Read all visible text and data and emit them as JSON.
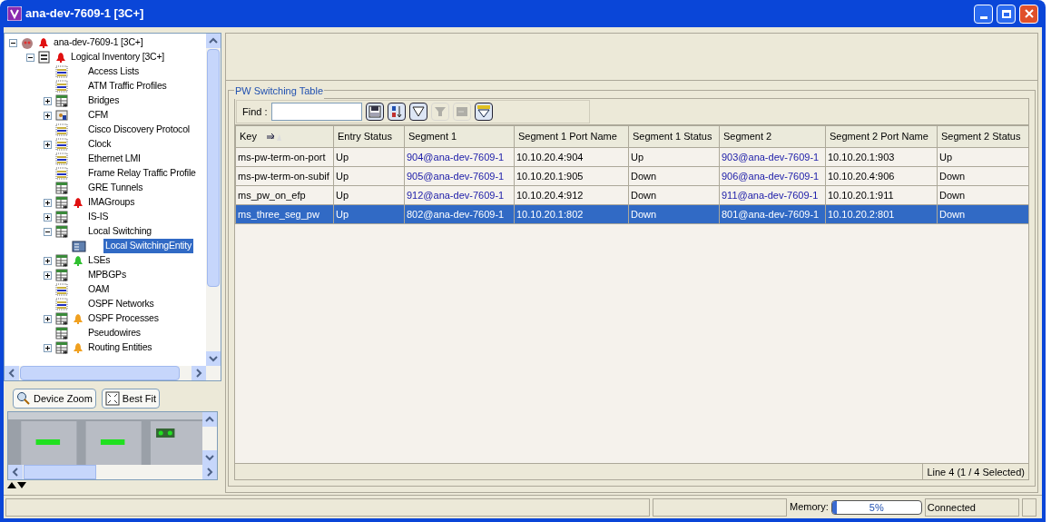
{
  "window": {
    "title": "ana-dev-7609-1 [3C+]"
  },
  "tree": [
    {
      "label": "ana-dev-7609-1 [3C+]",
      "kind": "device",
      "expanded": true,
      "selected": false,
      "color": "#e01010",
      "children": [
        {
          "label": "Logical Inventory [3C+]",
          "kind": "inventory",
          "expanded": true,
          "selected": false,
          "color": "#e01010",
          "children": [
            {
              "label": "Access Lists",
              "kind": "list",
              "selected": false
            },
            {
              "label": "ATM Traffic Profiles",
              "kind": "list",
              "selected": false
            },
            {
              "label": "Bridges",
              "kind": "table",
              "expanded": false,
              "selected": false
            },
            {
              "label": "CFM",
              "kind": "cfm",
              "expanded": false,
              "selected": false
            },
            {
              "label": "Cisco Discovery Protocol",
              "kind": "list",
              "selected": false
            },
            {
              "label": "Clock",
              "kind": "list",
              "expanded": false,
              "selected": false
            },
            {
              "label": "Ethernet LMI",
              "kind": "list",
              "selected": false
            },
            {
              "label": "Frame Relay Traffic Profile",
              "kind": "list",
              "selected": false
            },
            {
              "label": "GRE Tunnels",
              "kind": "table",
              "selected": false
            },
            {
              "label": "IMAGroups",
              "kind": "table",
              "expanded": false,
              "selected": false,
              "color": "#e01010"
            },
            {
              "label": "IS-IS",
              "kind": "table",
              "expanded": false,
              "selected": false
            },
            {
              "label": "Local Switching",
              "kind": "table",
              "expanded": true,
              "selected": false,
              "children": [
                {
                  "label": "Local SwitchingEntity",
                  "kind": "entity",
                  "selected": true
                }
              ]
            },
            {
              "label": "LSEs",
              "kind": "table",
              "expanded": false,
              "selected": false,
              "color": "#30c030"
            },
            {
              "label": "MPBGPs",
              "kind": "table",
              "expanded": false,
              "selected": false
            },
            {
              "label": "OAM",
              "kind": "list",
              "selected": false
            },
            {
              "label": "OSPF Networks",
              "kind": "list",
              "selected": false
            },
            {
              "label": "OSPF Processes",
              "kind": "table",
              "expanded": false,
              "selected": false,
              "color": "#f0a020"
            },
            {
              "label": "Pseudowires",
              "kind": "table",
              "selected": false
            },
            {
              "label": "Routing Entities",
              "kind": "table",
              "expanded": false,
              "selected": false,
              "color": "#f0a020"
            }
          ]
        }
      ]
    }
  ],
  "view_buttons": [
    {
      "label": "Device Zoom",
      "kind": "zoom"
    },
    {
      "label": "Best Fit",
      "kind": "fit"
    }
  ],
  "table": {
    "title": "PW Switching Table",
    "find_label": "Find :",
    "toolbar": [
      {
        "kind": "save",
        "disabled": false
      },
      {
        "kind": "sort",
        "disabled": false
      },
      {
        "kind": "filter",
        "disabled": false
      },
      {
        "kind": "clear-filter",
        "disabled": true
      },
      {
        "kind": "export",
        "disabled": true
      },
      {
        "kind": "filter-settings",
        "disabled": false
      }
    ],
    "columns": [
      "Key",
      "Entry Status",
      "Segment 1",
      "Segment 1 Port Name",
      "Segment 1 Status",
      "Segment 2",
      "Segment 2 Port Name",
      "Segment 2 Status"
    ],
    "rows": [
      {
        "selected": false,
        "cells": [
          "ms-pw-term-on-port",
          "Up",
          "904@ana-dev-7609-1",
          "10.10.20.4:904",
          "Up",
          "903@ana-dev-7609-1",
          "10.10.20.1:903",
          "Up"
        ]
      },
      {
        "selected": false,
        "cells": [
          "ms-pw-term-on-subif",
          "Up",
          "905@ana-dev-7609-1",
          "10.10.20.1:905",
          "Down",
          "906@ana-dev-7609-1",
          "10.10.20.4:906",
          "Down"
        ]
      },
      {
        "selected": false,
        "cells": [
          "ms_pw_on_efp",
          "Up",
          "912@ana-dev-7609-1",
          "10.10.20.4:912",
          "Down",
          "911@ana-dev-7609-1",
          "10.10.20.1:911",
          "Down"
        ]
      },
      {
        "selected": true,
        "cells": [
          "ms_three_seg_pw",
          "Up",
          "802@ana-dev-7609-1",
          "10.10.20.1:802",
          "Down",
          "801@ana-dev-7609-1",
          "10.10.20.2:801",
          "Down"
        ]
      }
    ],
    "footer": "Line 4 (1 / 4 Selected)"
  },
  "status_bar": {
    "memory_label": "Memory:",
    "memory": {
      "level": 0.05,
      "reading": "5%"
    },
    "connection": "Connected"
  }
}
